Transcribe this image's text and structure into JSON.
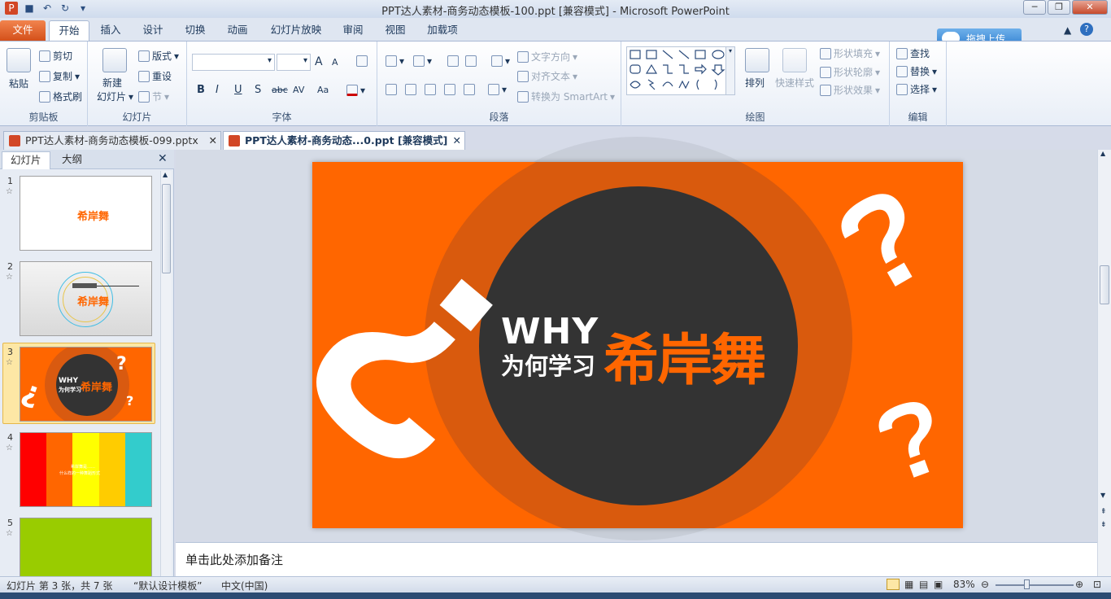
{
  "window": {
    "title": "PPT达人素材-商务动态模板-100.ppt [兼容模式]  -  Microsoft PowerPoint",
    "upload_label": "拖拽上传"
  },
  "ribbon_tabs": [
    "文件",
    "开始",
    "插入",
    "设计",
    "切换",
    "动画",
    "幻灯片放映",
    "审阅",
    "视图",
    "加载项"
  ],
  "ribbon": {
    "clipboard": {
      "paste": "粘贴",
      "cut": "剪切",
      "copy": "复制",
      "format_painter": "格式刷",
      "label": "剪贴板"
    },
    "slides": {
      "new_slide": "新建",
      "new_slide2": "幻灯片",
      "layout": "版式",
      "reset": "重设",
      "section": "节",
      "label": "幻灯片"
    },
    "font": {
      "label": "字体",
      "bold": "B",
      "italic": "I",
      "underline": "U",
      "shadow": "S",
      "strike": "abc",
      "spacing": "AV",
      "case": "Aa",
      "grow": "A",
      "shrink": "A"
    },
    "paragraph": {
      "text_direction": "文字方向",
      "align_text": "对齐文本",
      "smartart": "转换为 SmartArt",
      "label": "段落"
    },
    "drawing": {
      "arrange": "排列",
      "quick_styles": "快速样式",
      "fill": "形状填充",
      "outline": "形状轮廓",
      "effects": "形状效果",
      "label": "绘图"
    },
    "editing": {
      "find": "查找",
      "replace": "替换",
      "select": "选择",
      "label": "编辑"
    }
  },
  "doc_tabs": [
    {
      "label": "PPT达人素材-商务动态模板-099.pptx"
    },
    {
      "label": "PPT达人素材-商务动态...0.ppt [兼容模式]"
    }
  ],
  "left_pane": {
    "tab_slides": "幻灯片",
    "tab_outline": "大纲",
    "slides": [
      {
        "num": "1",
        "title": "希岸舞"
      },
      {
        "num": "2",
        "title": "希岸舞"
      },
      {
        "num": "3",
        "title_en": "WHY",
        "title_cn": "为何学习",
        "title": "希岸舞"
      },
      {
        "num": "4",
        "line1": "希岸舞是……",
        "line2": "什么样的一种舞蹈形式"
      },
      {
        "num": "5"
      }
    ]
  },
  "slide": {
    "why": "WHY",
    "subtitle": "为何学习",
    "title": "希岸舞",
    "bg_color": "#ff6600",
    "circle_color": "#333333"
  },
  "notes_placeholder": "单击此处添加备注",
  "status": {
    "slide_info": "幻灯片 第 3 张，共 7 张",
    "theme": "“默认设计模板”",
    "language": "中文(中国)",
    "zoom": "83%"
  }
}
